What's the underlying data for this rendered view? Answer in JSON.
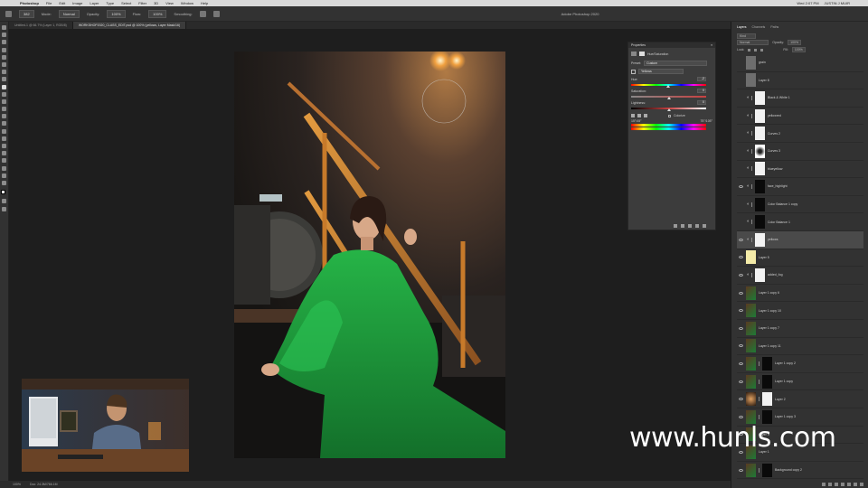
{
  "menubar": {
    "app": "Photoshop",
    "items": [
      "File",
      "Edit",
      "Image",
      "Layer",
      "Type",
      "Select",
      "Filter",
      "3D",
      "View",
      "Window",
      "Help"
    ],
    "clock": "Wed 2:07 PM",
    "user": "JUSTIN J MUIR"
  },
  "window_title": "Adobe Photoshop 2020",
  "options": {
    "mode_label": "Mode:",
    "mode_value": "Normal",
    "opacity_label": "Opacity:",
    "opacity_value": "100%",
    "flow_label": "Flow:",
    "flow_value": "100%",
    "smoothing_label": "Smoothing:",
    "size_value": "382"
  },
  "doc_tabs": [
    "Untitled-1 @ 66.7% (Layer 1, RGB/8)",
    "WORKSHOP2020_CLASS_EDIT.psd @ 100% (yellows, Layer Mask/16)"
  ],
  "status": {
    "zoom": "100%",
    "doc": "Doc: 24.3M/766.1M"
  },
  "properties": {
    "title": "Properties",
    "panel_name": "Hue/Saturation",
    "preset_label": "Preset:",
    "preset_value": "Custom",
    "channel_value": "Yellows",
    "hue_label": "Hue:",
    "hue_value": "-2",
    "saturation_label": "Saturation:",
    "saturation_value": "0",
    "lightness_label": "Lightness:",
    "lightness_value": "0",
    "colorize_label": "Colorize",
    "range_left": "15°/45°",
    "range_right": "75°/105°",
    "levels": {
      "hue": 0.49,
      "saturation": 0.5,
      "lightness": 0.5
    }
  },
  "layers_panel": {
    "tabs": [
      "Layers",
      "Channels",
      "Paths"
    ],
    "filter_label": "Kind",
    "blend_mode": "Normal",
    "opacity_label": "Opacity:",
    "opacity_value": "100%",
    "lock_label": "Lock:",
    "fill_label": "Fill:",
    "fill_value": "100%",
    "layers": [
      {
        "name": "grain",
        "visible": false,
        "kind": "gray"
      },
      {
        "name": "Layer 8",
        "visible": false,
        "kind": "gray"
      },
      {
        "name": "Black & White 1",
        "visible": false,
        "kind": "adj-white"
      },
      {
        "name": "yellowred",
        "visible": false,
        "kind": "adj-white"
      },
      {
        "name": "Curves 2",
        "visible": false,
        "kind": "adj-white"
      },
      {
        "name": "Curves 3",
        "visible": false,
        "kind": "adj-spot"
      },
      {
        "name": "blueyellow",
        "visible": false,
        "kind": "adj-white"
      },
      {
        "name": "face_highlight",
        "visible": true,
        "kind": "adj-black"
      },
      {
        "name": "Color Balance 1 copy",
        "visible": false,
        "kind": "adj-black"
      },
      {
        "name": "Color Balance 1",
        "visible": false,
        "kind": "adj-black"
      },
      {
        "name": "yellows",
        "visible": true,
        "kind": "adj-white",
        "selected": true
      },
      {
        "name": "Layer 5",
        "visible": true,
        "kind": "yellow"
      },
      {
        "name": "added_fog",
        "visible": true,
        "kind": "adj-white"
      },
      {
        "name": "Layer 1 copy 6",
        "visible": true,
        "kind": "photo"
      },
      {
        "name": "Layer 1 copy 10",
        "visible": true,
        "kind": "photo"
      },
      {
        "name": "Layer 1 copy 7",
        "visible": true,
        "kind": "photo"
      },
      {
        "name": "Layer 1 copy 11",
        "visible": true,
        "kind": "photo"
      },
      {
        "name": "Layer 1 copy 2",
        "visible": true,
        "kind": "photo-black"
      },
      {
        "name": "Layer 1 copy",
        "visible": true,
        "kind": "photo-black"
      },
      {
        "name": "Layer 2",
        "visible": true,
        "kind": "warm-white"
      },
      {
        "name": "Layer 1 copy 3",
        "visible": true,
        "kind": "photo-black"
      },
      {
        "name": "Layer 4",
        "visible": true,
        "kind": "photo"
      },
      {
        "name": "Layer 1",
        "visible": true,
        "kind": "photo"
      },
      {
        "name": "Background copy 2",
        "visible": true,
        "kind": "photo-black"
      }
    ]
  },
  "watermark": "www.hunls.com",
  "colors": {
    "accent": "#4a90e2",
    "dress_green": "#1f9a3a",
    "rail_orange": "#c77a2a"
  }
}
